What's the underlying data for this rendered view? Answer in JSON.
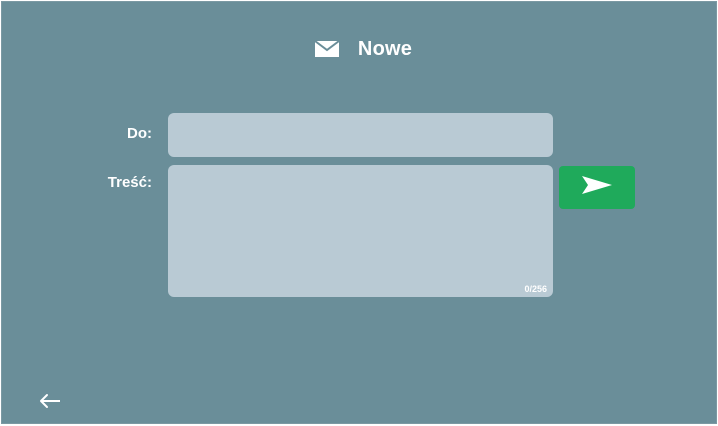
{
  "header": {
    "icon": "envelope-icon",
    "title": "Nowe"
  },
  "form": {
    "to_label": "Do:",
    "to_value": "",
    "body_label": "Treść:",
    "body_value": "",
    "char_counter": "0/256"
  },
  "actions": {
    "send_icon": "send-arrow-icon",
    "back_icon": "back-arrow-icon"
  },
  "colors": {
    "background": "#6a8e99",
    "field": "#b9cad4",
    "send_button": "#1faa5b",
    "text": "#ffffff"
  }
}
